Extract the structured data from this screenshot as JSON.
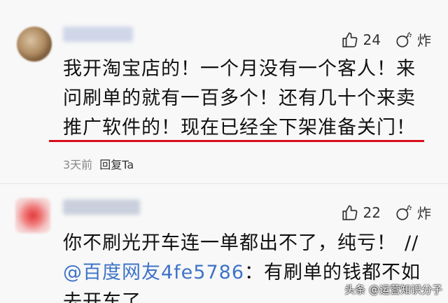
{
  "comments": [
    {
      "username": "",
      "likes": "24",
      "zha_label": "炸",
      "text": "我开淘宝店的！一个月没有一个客人！来问刷单的就有一百多个！还有几十个来卖推广软件的！现在已经全下架准备关门！",
      "time": "3天前",
      "reply_label": "回复Ta"
    },
    {
      "username": "",
      "likes": "22",
      "zha_label": "炸",
      "text": "你不刷光开车连一单都出不了，纯亏！",
      "slashes": "//",
      "mention": "@百度网友4fe5786",
      "reply_text": "：有刷单的钱都不如",
      "cut_text": "去开车了。"
    }
  ],
  "watermark": "头条 @运营知识分子",
  "accent_color": "#d80f1a",
  "mention_color": "#3e73c8"
}
